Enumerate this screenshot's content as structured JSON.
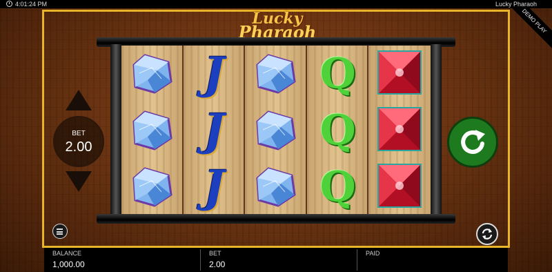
{
  "topbar": {
    "time": "4:01:24 PM",
    "game_title": "Lucky Pharaoh"
  },
  "ribbon": {
    "label": "DEMO PLAY"
  },
  "logo": {
    "line1": "Lucky",
    "line2": "Pharaoh"
  },
  "bet_control": {
    "label": "BET",
    "value": "2.00"
  },
  "reels": [
    [
      "blue-diamond",
      "blue-diamond",
      "blue-diamond"
    ],
    [
      "J",
      "J",
      "J"
    ],
    [
      "blue-diamond",
      "blue-diamond",
      "blue-diamond"
    ],
    [
      "Q",
      "Q",
      "Q"
    ],
    [
      "red-ruby",
      "red-ruby",
      "red-ruby"
    ]
  ],
  "footer": {
    "balance_label": "BALANCE",
    "balance_value": "1,000.00",
    "bet_label": "BET",
    "bet_value": "2.00",
    "paid_label": "PAID",
    "paid_value": ""
  },
  "icons": {
    "spin": "spin-arrow-icon",
    "menu": "menu-icon",
    "autoplay": "autoplay-icon",
    "clock": "clock-icon"
  },
  "colors": {
    "frame": "#e8b52a",
    "spin": "#1e7a1e",
    "j_symbol": "#1b3fbf",
    "q_symbol": "#4fd13a"
  }
}
